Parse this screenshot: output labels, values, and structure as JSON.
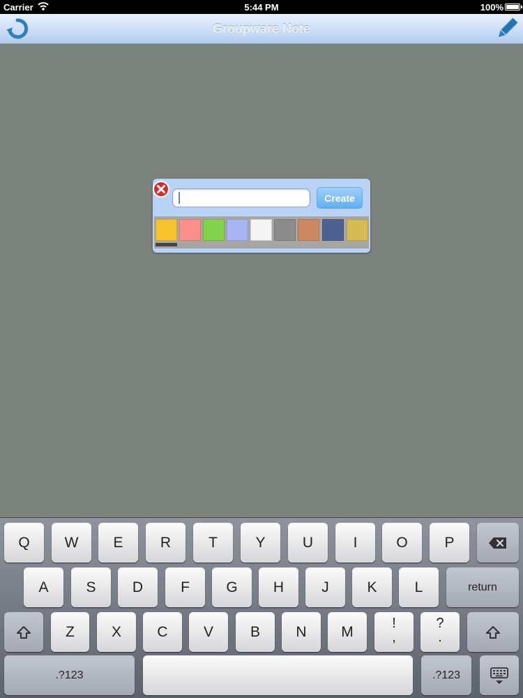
{
  "status_bar": {
    "carrier": "Carrier",
    "time": "5:44 PM",
    "battery": "100%"
  },
  "nav": {
    "title": "Groupware Note",
    "left_icon": "refresh-icon",
    "right_icon": "pencil-icon"
  },
  "popup": {
    "input_value": "",
    "create_label": "Create",
    "close_icon": "close-icon",
    "colors": [
      "#f6c22d",
      "#fb8f8c",
      "#82d34b",
      "#aab5f5",
      "#f4f4f4",
      "#8c8c8c",
      "#cc8763",
      "#4f6190",
      "#d6bb55"
    ],
    "selected_color": 0
  },
  "keyboard": {
    "row1": [
      "Q",
      "W",
      "E",
      "R",
      "T",
      "Y",
      "U",
      "I",
      "O",
      "P"
    ],
    "row2": [
      "A",
      "S",
      "D",
      "F",
      "G",
      "H",
      "J",
      "K",
      "L"
    ],
    "return_label": "return",
    "row3": [
      "Z",
      "X",
      "C",
      "V",
      "B",
      "N",
      "M"
    ],
    "punct1": [
      "!",
      ","
    ],
    "punct2": [
      "?",
      "."
    ],
    "numbers_label": ".?123",
    "numbers_label_right": ".?123"
  }
}
